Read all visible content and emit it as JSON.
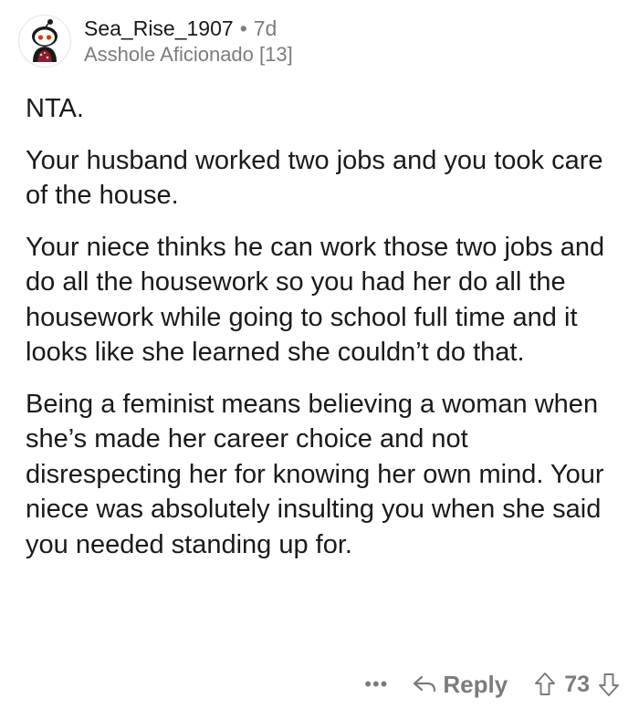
{
  "comment": {
    "author": {
      "username": "Sea_Rise_1907",
      "age": "7d",
      "separator": "•",
      "flair": "Asshole Aficionado [13]",
      "avatar_icon": "snoo-avatar-icon"
    },
    "paragraphs": [
      "NTA.",
      "Your husband worked two jobs and you took care of the house.",
      "Your niece thinks he can work those two jobs and do all the housework so you had her do all the housework while going to school full time and it looks like she learned she couldn’t do that.",
      "Being a feminist means believing a woman when she’s made her career choice and not disrespecting her for knowing her own mind. Your niece was absolutely insulting you when she said you needed standing up for."
    ],
    "actions": {
      "more_label": "•••",
      "reply_label": "Reply",
      "vote_count": "73"
    }
  },
  "colors": {
    "text": "#1a1a1b",
    "meta": "#7c7c7c",
    "avatar_accent": "#d93a00"
  }
}
